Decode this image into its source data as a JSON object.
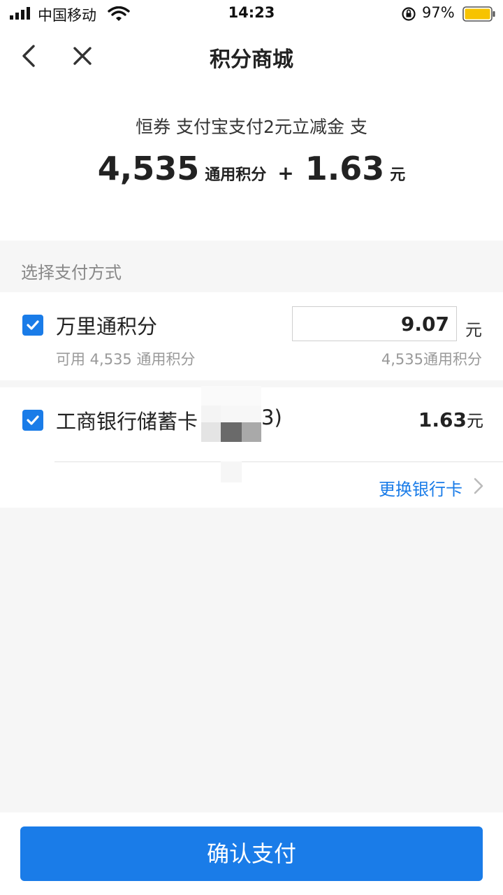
{
  "status_bar": {
    "carrier": "中国移动",
    "time": "14:23",
    "battery": "97%",
    "icons": [
      "signal-icon",
      "wifi-icon",
      "orientation-lock-icon",
      "battery-icon"
    ],
    "battery_color": "#f7c300"
  },
  "nav": {
    "title": "积分商城",
    "back_icon": "chevron-left-icon",
    "close_icon": "close-icon"
  },
  "summary": {
    "description": "恒券 支付宝支付2元立减金 支",
    "points": "4,535",
    "points_unit": "通用积分",
    "plus": "+",
    "cash": "1.63",
    "cash_unit": "元"
  },
  "payment": {
    "section_title": "选择支付方式",
    "methods": [
      {
        "name": "万里通积分",
        "checked": true,
        "sub": "可用 4,535 通用积分",
        "input_value": "9.07",
        "unit": "元",
        "right_sub": "4,535通用积分"
      },
      {
        "name": "工商银行储蓄卡",
        "suffix": "3)",
        "checked": true,
        "amount": "1.63",
        "amount_unit": "元",
        "change_card": "更换银行卡",
        "change_icon": "chevron-right-icon"
      }
    ]
  },
  "confirm_button": "确认支付",
  "accent_color": "#1a7ce8"
}
